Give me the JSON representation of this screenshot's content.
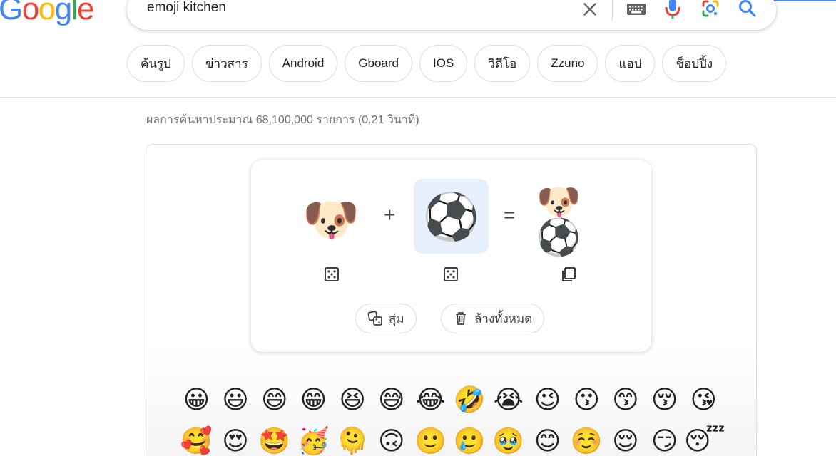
{
  "logo": {
    "letters": [
      "G",
      "o",
      "o",
      "g",
      "l",
      "e"
    ],
    "colors": [
      "#4285F4",
      "#EA4335",
      "#FBBC05",
      "#4285F4",
      "#34A853",
      "#EA4335"
    ]
  },
  "search": {
    "query": "emoji kitchen"
  },
  "icons": {
    "clear": "close-icon",
    "keyboard": "keyboard-icon",
    "mic": "microphone-icon",
    "lens": "google-lens-icon",
    "search": "search-icon"
  },
  "chips": [
    "ค้นรูป",
    "ข่าวสาร",
    "Android",
    "Gboard",
    "IOS",
    "วิดีโอ",
    "Zzuno",
    "แอป",
    "ช็อปปิ้ง"
  ],
  "results_stats": "ผลการค้นหาประมาณ 68,100,000 รายการ (0.21 วินาที)",
  "kitchen": {
    "left_emoji": "🐶",
    "right_emoji": "⚽",
    "result_emoji": "🐶⚽",
    "plus": "+",
    "equals": "=",
    "random_label": "สุ่ม",
    "clear_label": "ล้างทั้งหมด"
  },
  "emoji_grid": [
    "😀",
    "😃",
    "😄",
    "😁",
    "😆",
    "😅",
    "😂",
    "🤣",
    "😭",
    "😉",
    "😗",
    "😙",
    "😚",
    "😘",
    "🥰",
    "😍",
    "🤩",
    "🥳",
    "🫠",
    "🙃",
    "🙂",
    "🥲",
    "🥹",
    "😊",
    "☺️",
    "😌",
    "😏",
    "😴"
  ],
  "colors": {
    "accent": "#4285f4",
    "selected_bg": "#e8f0fe",
    "mic_red": "#EA4335"
  }
}
